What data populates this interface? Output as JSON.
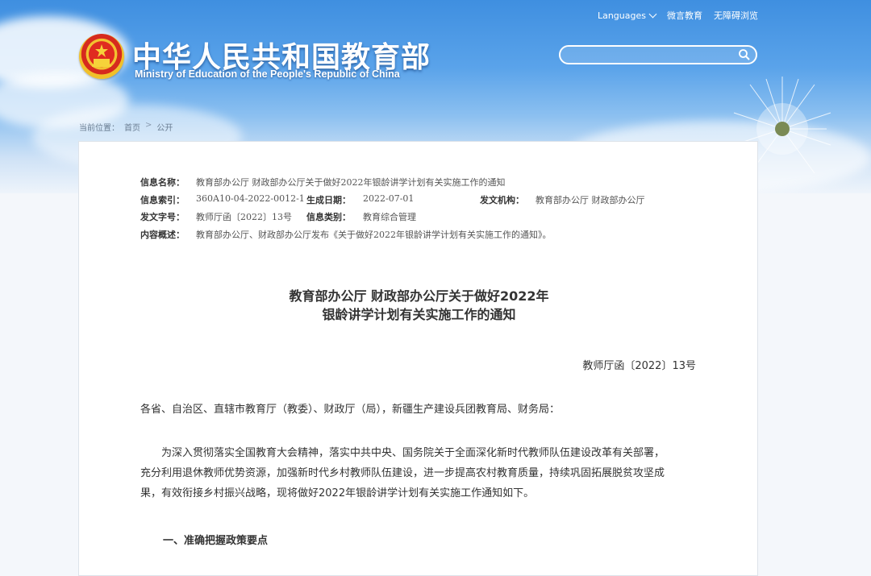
{
  "header": {
    "site_title": "中华人民共和国教育部",
    "site_subtitle": "Ministry of Education of the People's Republic of China",
    "links": {
      "languages": "Languages",
      "weibo": "微言教育",
      "accessible": "无障碍浏览"
    },
    "search_placeholder": ""
  },
  "breadcrumb": {
    "current_label": "当前位置：",
    "home": "首页",
    "separator": ">",
    "section": "公开"
  },
  "meta": {
    "name_label": "信息名称：",
    "name_value": "教育部办公厅 财政部办公厅关于做好2022年银龄讲学计划有关实施工作的通知",
    "index_label": "信息索引：",
    "index_value": "360A10-04-2022-0012-1",
    "date_label": "生成日期：",
    "date_value": "2022-07-01",
    "issuer_label": "发文机构：",
    "issuer_value": "教育部办公厅 财政部办公厅",
    "docno_label": "发文字号：",
    "docno_value": "教师厅函〔2022〕13号",
    "category_label": "信息类别：",
    "category_value": "教育综合管理",
    "summary_label": "内容概述：",
    "summary_value": "教育部办公厅、财政部办公厅发布《关于做好2022年银龄讲学计划有关实施工作的通知》。"
  },
  "document": {
    "title_line1": "教育部办公厅 财政部办公厅关于做好2022年",
    "title_line2": "银龄讲学计划有关实施工作的通知",
    "doc_number": "教师厅函〔2022〕13号",
    "salutation": "各省、自治区、直辖市教育厅（教委）、财政厅（局），新疆生产建设兵团教育局、财务局：",
    "para1_line1": "为深入贯彻落实全国教育大会精神，落实中共中央、国务院关于全面深化新时代教师队伍建设改革有关部署，",
    "para1_line2": "充分利用退休教师优势资源，加强新时代乡村教师队伍建设，进一步提高农村教育质量，持续巩固拓展脱贫攻坚成",
    "para1_line3": "果，有效衔接乡村振兴战略，现将做好2022年银龄讲学计划有关实施工作通知如下。",
    "section1": "一、准确把握政策要点"
  },
  "colors": {
    "sky_top": "#3f8fe0",
    "panel_bg": "#ffffff",
    "text": "#333333"
  }
}
